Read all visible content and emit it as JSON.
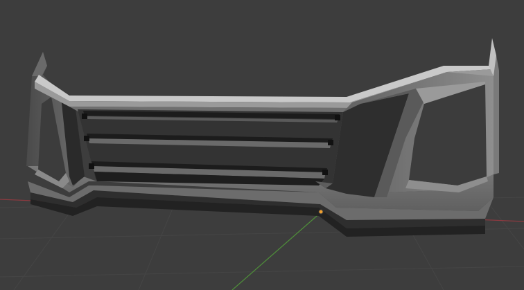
{
  "viewport": {
    "mode": "3D viewport",
    "shading": "solid"
  },
  "colors": {
    "background": "#3d3d3d",
    "grid_line": "#474747",
    "x_axis": "#a4434b",
    "y_axis": "#4b8a3a",
    "origin_point": "#f0a030",
    "mesh_light": "#7c7c7c",
    "mesh_mid": "#5e5e5e",
    "mesh_dark": "#2b2b2b",
    "mesh_highlight": "#c8c8c8"
  },
  "scene_objects": [
    {
      "name": "front-bumper-grille",
      "type": "mesh",
      "selected": false
    }
  ]
}
